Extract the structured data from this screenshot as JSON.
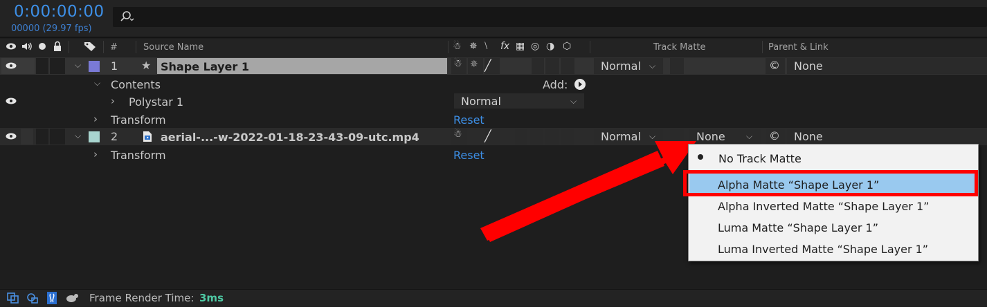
{
  "header": {
    "timecode": "0:00:00:00",
    "frame_info": "00000 (29.97 fps)",
    "search_value": ""
  },
  "columns": {
    "number": "#",
    "source_name": "Source Name",
    "track_matte": "Track Matte",
    "parent_link": "Parent & Link"
  },
  "layers": [
    {
      "num": "1",
      "name": "Shape Layer 1",
      "mode": "Normal",
      "parent": "None",
      "label_color": "#7a7ad6"
    },
    {
      "num": "2",
      "name": "aerial-...-w-2022-01-18-23-43-09-utc.mp4",
      "mode": "Normal",
      "track_matte": "None",
      "parent": "None",
      "label_color": "#a8d4cf"
    }
  ],
  "props": {
    "contents": "Contents",
    "add_label": "Add:",
    "polystar": "Polystar 1",
    "polystar_mode": "Normal",
    "transform": "Transform",
    "reset": "Reset"
  },
  "track_matte_menu": {
    "items": [
      "No Track Matte",
      "Alpha Matte “Shape Layer 1”",
      "Alpha Inverted Matte “Shape Layer 1”",
      "Luma Matte “Shape Layer 1”",
      "Luma Inverted Matte “Shape Layer 1”"
    ],
    "selected_index": 0,
    "highlighted_index": 1
  },
  "footer": {
    "label": "Frame Render Time:",
    "value": "3ms"
  },
  "colors": {
    "accent_blue": "#3d8fe6",
    "annotation_red": "#ff0000",
    "highlight": "#99c9ef",
    "render_time_green": "#4ec9a4"
  }
}
